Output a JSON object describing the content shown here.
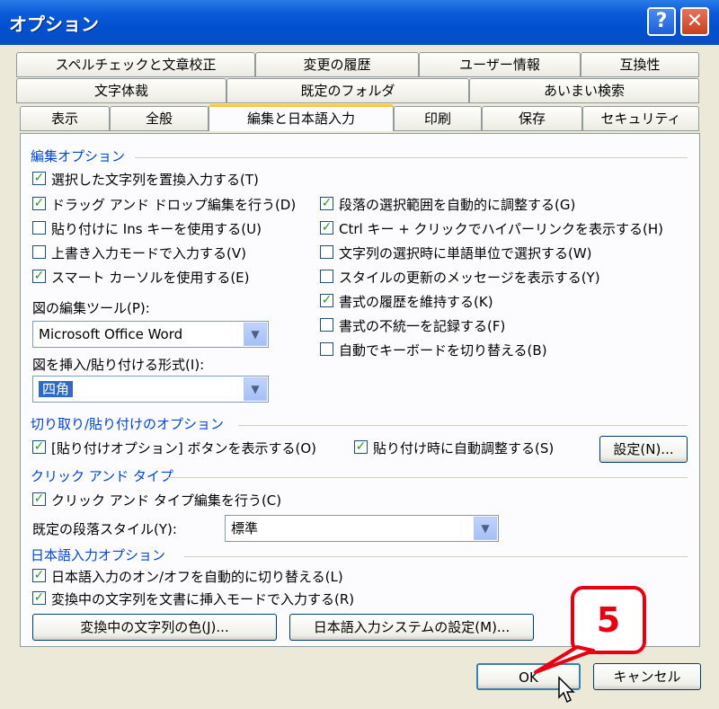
{
  "window": {
    "title": "オプション"
  },
  "titlebar": {
    "help_label": "?",
    "close_label": "✕"
  },
  "tabs": {
    "row1": [
      "スペルチェックと文章校正",
      "変更の履歴",
      "ユーザー情報",
      "互換性"
    ],
    "row2": [
      "文字体裁",
      "既定のフォルダ",
      "あいまい検索"
    ],
    "row3": [
      "表示",
      "全般",
      "編集と日本語入力",
      "印刷",
      "保存",
      "セキュリティ"
    ],
    "active": "編集と日本語入力"
  },
  "edit_options": {
    "header": "編集オプション",
    "left": [
      {
        "label": "選択した文字列を置換入力する(T)",
        "checked": true
      },
      {
        "label": "ドラッグ アンド ドロップ編集を行う(D)",
        "checked": true
      },
      {
        "label": "貼り付けに Ins キーを使用する(U)",
        "checked": false
      },
      {
        "label": "上書き入力モードで入力する(V)",
        "checked": false
      },
      {
        "label": "スマート カーソルを使用する(E)",
        "checked": true
      }
    ],
    "right": [
      {
        "label": "段落の選択範囲を自動的に調整する(G)",
        "checked": true
      },
      {
        "label": "Ctrl キー + クリックでハイパーリンクを表示する(H)",
        "checked": true
      },
      {
        "label": "文字列の選択時に単語単位で選択する(W)",
        "checked": false
      },
      {
        "label": "スタイルの更新のメッセージを表示する(Y)",
        "checked": false
      },
      {
        "label": "書式の履歴を維持する(K)",
        "checked": true
      },
      {
        "label": "書式の不統一を記録する(F)",
        "checked": false
      },
      {
        "label": "自動でキーボードを切り替える(B)",
        "checked": false
      }
    ],
    "picture_tool_label": "図の編集ツール(P):",
    "picture_tool_value": "Microsoft Office Word",
    "insert_style_label": "図を挿入/貼り付ける形式(I):",
    "insert_style_value": "四角"
  },
  "cut_paste": {
    "header": "切り取り/貼り付けのオプション",
    "show_button": {
      "label": "[貼り付けオプション] ボタンを表示する(O)",
      "checked": true
    },
    "smart_paste": {
      "label": "貼り付け時に自動調整する(S)",
      "checked": true
    },
    "settings_button": "設定(N)..."
  },
  "click_type": {
    "header": "クリック アンド タイプ",
    "enable": {
      "label": "クリック アンド タイプ編集を行う(C)",
      "checked": true
    },
    "default_style_label": "既定の段落スタイル(Y):",
    "default_style_value": "標準"
  },
  "ime": {
    "header": "日本語入力オプション",
    "auto_switch": {
      "label": "日本語入力のオン/オフを自動的に切り替える(L)",
      "checked": true
    },
    "insert_mode": {
      "label": "変換中の文字列を文書に挿入モードで入力する(R)",
      "checked": true
    },
    "color_button": "変換中の文字列の色(J)...",
    "ime_settings_button": "日本語入力システムの設定(M)..."
  },
  "footer": {
    "ok": "OK",
    "cancel": "キャンセル"
  },
  "annotation": {
    "step": "5"
  },
  "colors": {
    "titlebar": "#0a5ad9",
    "accent_tab": "#ffc83c",
    "section": "#0046d5",
    "callout": "#e60012"
  }
}
